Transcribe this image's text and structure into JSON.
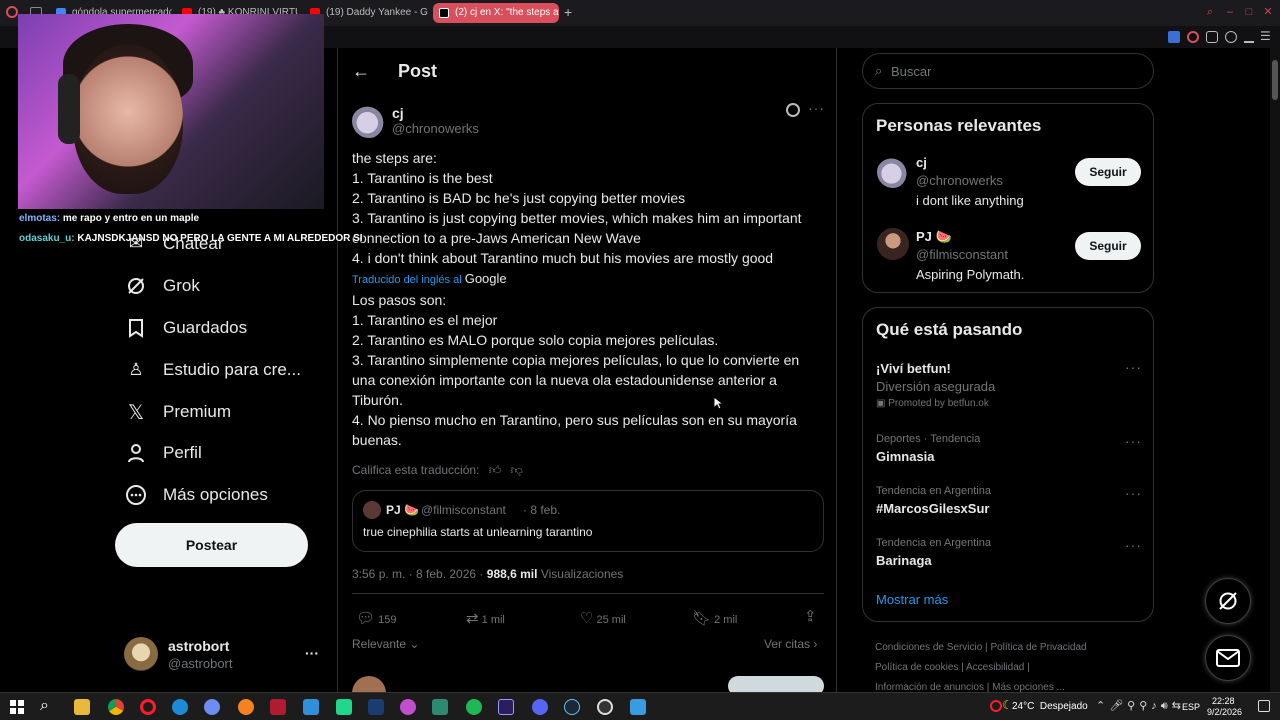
{
  "browser": {
    "tabs": [
      {
        "label": "góndola supermercado - B",
        "color": "#4285f4"
      },
      {
        "label": "(19) ♣ KONRINI VIRTUAL",
        "color": "#ff0000"
      },
      {
        "label": "(19) Daddy Yankee - Gasol",
        "color": "#ff0000"
      },
      {
        "label": "(2) cj en X: \"the steps are:",
        "color": "#000000"
      }
    ],
    "new_tab": "+"
  },
  "stream": {
    "chat": [
      {
        "user": "elmotas:",
        "message": "me rapo y entro en un maple"
      },
      {
        "user": "odasaku_u:",
        "message": "KAJNSDKJANSD NO PERO LA GENTE A MI ALREDEDOR SI"
      }
    ]
  },
  "nav": {
    "items": [
      {
        "label": "Chatear",
        "icon": "chat-icon"
      },
      {
        "label": "Grok",
        "icon": "grok-icon"
      },
      {
        "label": "Guardados",
        "icon": "bookmark-icon"
      },
      {
        "label": "Estudio para cre...",
        "icon": "studio-icon"
      },
      {
        "label": "Premium",
        "icon": "x-logo-icon"
      },
      {
        "label": "Perfil",
        "icon": "profile-icon"
      },
      {
        "label": "Más opciones",
        "icon": "more-icon"
      }
    ],
    "post_button": "Postear",
    "account": {
      "name": "astrobort",
      "handle": "@astrobort",
      "more": "···"
    }
  },
  "post": {
    "header_title": "Post",
    "author_name": "cj",
    "author_handle": "@chronowerks",
    "original_lines": [
      "the steps are:",
      "1. Tarantino is the best",
      "2. Tarantino is BAD bc he's just copying better movies",
      "3. Tarantino is just copying better movies, which makes him an important",
      "connection to a pre-Jaws American New Wave",
      "4. i don't think about Tarantino much but his movies are mostly good"
    ],
    "translated_by": "Traducido del inglés al",
    "translator": "Google",
    "translated_lines": [
      "Los pasos son:",
      "1. Tarantino es el mejor",
      "2. Tarantino es MALO porque solo copia mejores películas.",
      "3. Tarantino simplemente copia mejores películas, lo que lo convierte en",
      "una conexión importante con la nueva ola estadounidense anterior a",
      "Tiburón.",
      "4. No pienso mucho en Tarantino, pero sus películas son en su mayoría",
      "buenas."
    ],
    "rate_translation": "Califica esta traducción:",
    "quote": {
      "name": "PJ 🍉",
      "handle": "@filmisconstant",
      "date": "· 8 feb.",
      "text": "true cinephilia starts at unlearning tarantino"
    },
    "timestamp": "3:56 p. m. · 8 feb. 2026 ·",
    "views_count": "988,6 mil",
    "views_label": "Visualizaciones",
    "stats": {
      "replies": "159",
      "reposts": "1 mil",
      "likes": "25 mil",
      "bookmarks": "2 mil"
    },
    "sort_label": "Relevante",
    "quotes_link": "Ver citas"
  },
  "sidebar": {
    "search_placeholder": "Buscar",
    "relevant": {
      "title": "Personas relevantes",
      "people": [
        {
          "name": "cj",
          "handle": "@chronowerks",
          "bio": "i dont like anything",
          "button": "Seguir"
        },
        {
          "name": "PJ 🍉",
          "handle": "@filmisconstant",
          "bio": "Aspiring Polymath.",
          "button": "Seguir"
        }
      ]
    },
    "trending": {
      "title": "Qué está pasando",
      "items": [
        {
          "context": "",
          "name": "¡Viví betfun!",
          "sub": "Diversión asegurada",
          "promo": "Promoted by betfun.ok"
        },
        {
          "context": "Deportes · Tendencia",
          "name": "Gimnasia"
        },
        {
          "context": "Tendencia en Argentina",
          "name": "#MarcosGilesxSur"
        },
        {
          "context": "Tendencia en Argentina",
          "name": "Barinaga"
        }
      ],
      "show_more": "Mostrar más"
    },
    "footer_links": [
      "Condiciones de Servicio",
      "Política de Privacidad",
      "Política de cookies",
      "Accesibilidad",
      "Información de anuncios",
      "Más opciones ..."
    ]
  },
  "taskbar": {
    "weather": "24°C  Despejado",
    "lang": "ESP",
    "time": "22:28",
    "date": "9/2/2026"
  },
  "colors": {
    "accent": "#1d9bf0",
    "tab_active": "#d94f5c",
    "muted": "#71767b"
  }
}
